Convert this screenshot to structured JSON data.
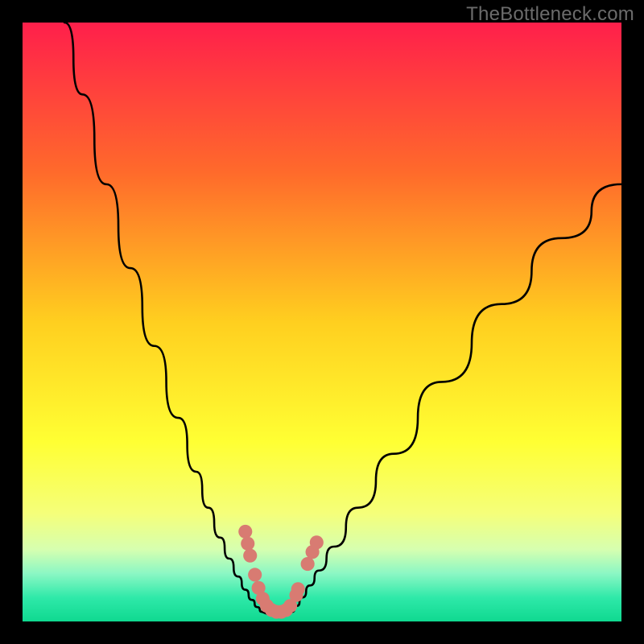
{
  "watermark": "TheBottleneck.com",
  "chart_data": {
    "type": "line",
    "title": "",
    "xlabel": "",
    "ylabel": "",
    "xlim": [
      0,
      100
    ],
    "ylim": [
      0,
      100
    ],
    "gradient": {
      "stops": [
        {
          "offset": 0,
          "color": "#ff1f4b"
        },
        {
          "offset": 0.25,
          "color": "#ff6a2b"
        },
        {
          "offset": 0.5,
          "color": "#ffcf1f"
        },
        {
          "offset": 0.7,
          "color": "#ffff33"
        },
        {
          "offset": 0.82,
          "color": "#f5ff7a"
        },
        {
          "offset": 0.88,
          "color": "#d6ffb0"
        },
        {
          "offset": 0.92,
          "color": "#8bf7c4"
        },
        {
          "offset": 0.96,
          "color": "#2fe9a9"
        },
        {
          "offset": 1.0,
          "color": "#0fd990"
        }
      ]
    },
    "series": [
      {
        "name": "left-branch",
        "x": [
          7,
          10,
          14,
          18,
          22,
          26,
          29,
          31,
          33,
          34.5,
          36,
          37.2,
          38.3,
          39.2,
          40
        ],
        "y": [
          100,
          88,
          73,
          59,
          46,
          34,
          25,
          19,
          14,
          10.5,
          7.5,
          5.3,
          3.6,
          2.4,
          1.6
        ]
      },
      {
        "name": "right-branch",
        "x": [
          45,
          45.8,
          46.7,
          48,
          49.5,
          52,
          56,
          62,
          70,
          80,
          90,
          100
        ],
        "y": [
          1.6,
          2.6,
          4.0,
          6.0,
          8.5,
          12.5,
          19,
          28,
          40,
          53,
          64,
          73
        ]
      },
      {
        "name": "floor",
        "x": [
          40,
          41,
          42,
          43,
          44,
          45
        ],
        "y": [
          1.6,
          1.2,
          1.0,
          1.0,
          1.2,
          1.6
        ]
      }
    ],
    "markers": {
      "name": "highlight-dots",
      "color": "#d87b72",
      "points": [
        {
          "x": 37.2,
          "y": 15.0
        },
        {
          "x": 37.6,
          "y": 13.0
        },
        {
          "x": 38.0,
          "y": 11.0
        },
        {
          "x": 38.8,
          "y": 7.8
        },
        {
          "x": 39.4,
          "y": 5.6
        },
        {
          "x": 40.1,
          "y": 3.8
        },
        {
          "x": 40.8,
          "y": 2.6
        },
        {
          "x": 41.6,
          "y": 1.9
        },
        {
          "x": 42.4,
          "y": 1.6
        },
        {
          "x": 43.2,
          "y": 1.6
        },
        {
          "x": 44.0,
          "y": 1.9
        },
        {
          "x": 44.7,
          "y": 2.6
        },
        {
          "x": 45.7,
          "y": 4.4
        },
        {
          "x": 46.0,
          "y": 5.4
        },
        {
          "x": 47.6,
          "y": 9.6
        },
        {
          "x": 48.4,
          "y": 11.6
        },
        {
          "x": 49.1,
          "y": 13.2
        }
      ]
    }
  }
}
